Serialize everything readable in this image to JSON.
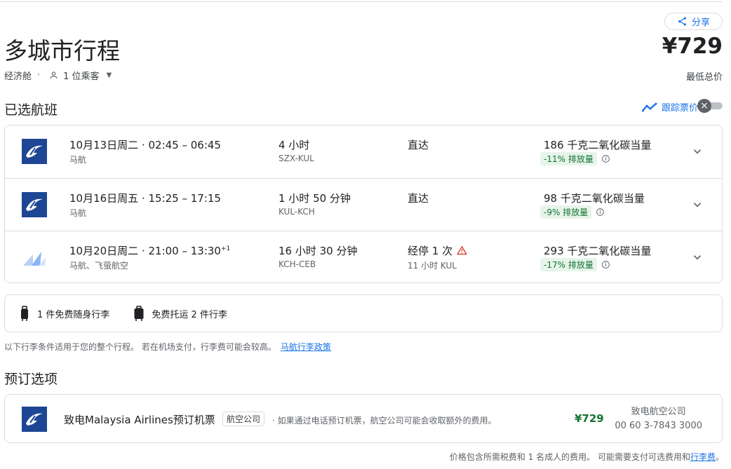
{
  "header": {
    "share_label": "分享",
    "title": "多城市行程",
    "price": "¥729",
    "price_caption": "最低总价",
    "cabin": "经济舱",
    "separator": "·",
    "passengers": "1 位乘客"
  },
  "selected": {
    "heading": "已选航班",
    "track_label": "跟踪票价",
    "track_enabled": false
  },
  "flights": [
    {
      "date_time": "10月13日周二 · 02:45 – 06:45",
      "day_offset": "",
      "airline": "马航",
      "duration": "4 小时",
      "route": "SZX-KUL",
      "stops": "直达",
      "stop_detail": "",
      "warning": false,
      "emissions": "186 千克二氧化碳当量",
      "emissions_badge": "-11% 排放量",
      "logo": "malaysia-airlines-logo"
    },
    {
      "date_time": "10月16日周五 · 15:25 – 17:15",
      "day_offset": "",
      "airline": "马航",
      "duration": "1 小时 50 分钟",
      "route": "KUL-KCH",
      "stops": "直达",
      "stop_detail": "",
      "warning": false,
      "emissions": "98 千克二氧化碳当量",
      "emissions_badge": "-9% 排放量",
      "logo": "malaysia-airlines-logo"
    },
    {
      "date_time": "10月20日周二 · 21:00 – 13:30",
      "day_offset": "+1",
      "airline": "马航、飞萤航空",
      "duration": "16 小时 30 分钟",
      "route": "KCH-CEB",
      "stops": "经停 1 次",
      "stop_detail": "11 小时 KUL",
      "warning": true,
      "emissions": "293 千克二氧化碳当量",
      "emissions_badge": "-17% 排放量",
      "logo": "multi-airline-logo"
    }
  ],
  "baggage": {
    "carry_on": "1 件免费随身行李",
    "checked": "免费托运 2 件行李",
    "note": "以下行李条件适用于您的整个行程。 若在机场支付，行李费可能会较高。",
    "policy_link": "马航行李政策"
  },
  "booking": {
    "heading": "预订选项",
    "name": "致电Malaysia Airlines预订机票",
    "tag": "航空公司",
    "desc": "· 如果通过电话预订机票，航空公司可能会收取额外的费用。",
    "price": "¥729",
    "call_label": "致电航空公司",
    "phone": "00 60 3-7843 3000"
  },
  "footer": {
    "text": "价格包含所需税费和 1 名成人的费用。 可能需要支付可选费用和",
    "link": "行李费",
    "end": "。"
  },
  "colors": {
    "accent": "#1a73e8",
    "green": "#137333",
    "badge_bg": "#e6f4ea",
    "mh_blue": "#1d4694",
    "warn": "#d93025"
  }
}
